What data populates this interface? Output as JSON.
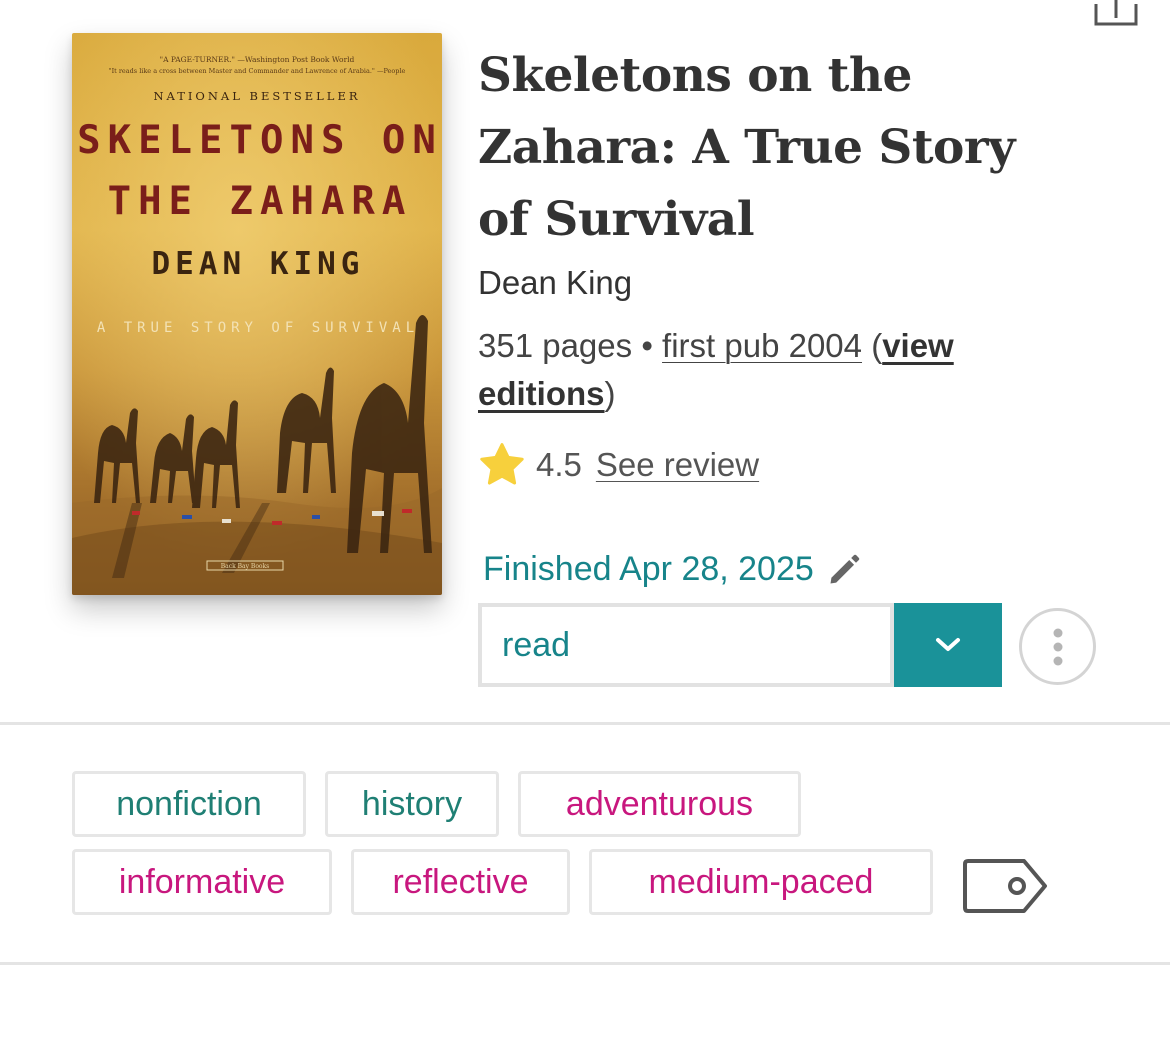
{
  "header": {
    "share_icon": "share-upload-icon"
  },
  "book": {
    "cover": {
      "quote_line1": "\"A PAGE-TURNER.\" —Washington Post Book World",
      "quote_line2": "\"It reads like a cross between Master and Commander and Lawrence of Arabia.\" —People",
      "badge": "NATIONAL BESTSELLER",
      "title_line1": "SKELETONS ON",
      "title_line2": "THE ZAHARA",
      "author": "DEAN KING",
      "subtitle": "A TRUE STORY OF SURVIVAL",
      "publisher": "Back Bay Books"
    },
    "title": "Skeletons on the Zahara: A True Story of Survival",
    "author": "Dean King",
    "pages": "351 pages",
    "separator": "•",
    "first_pub": "first pub 2004",
    "open_paren": "(",
    "view_editions": "view editions",
    "close_paren": ")"
  },
  "rating": {
    "icon": "star-icon",
    "value": "4.5",
    "review_link": "See review"
  },
  "reading": {
    "finished_text": "Finished Apr 28, 2025",
    "edit_icon": "pencil-icon",
    "status": "read",
    "dropdown_icon": "chevron-down-icon",
    "more_icon": "more-vertical-icon"
  },
  "tags": [
    {
      "label": "nonfiction",
      "kind": "genre"
    },
    {
      "label": "history",
      "kind": "genre"
    },
    {
      "label": "adventurous",
      "kind": "mood"
    },
    {
      "label": "informative",
      "kind": "mood"
    },
    {
      "label": "reflective",
      "kind": "mood"
    },
    {
      "label": "medium-paced",
      "kind": "pace"
    }
  ],
  "tag_icon": "tag-icon",
  "colors": {
    "teal": "#1a9299",
    "teal_text": "#17848a",
    "genre_green": "#1f7f74",
    "mood_pink": "#c8177e",
    "star": "#f7d03c"
  }
}
